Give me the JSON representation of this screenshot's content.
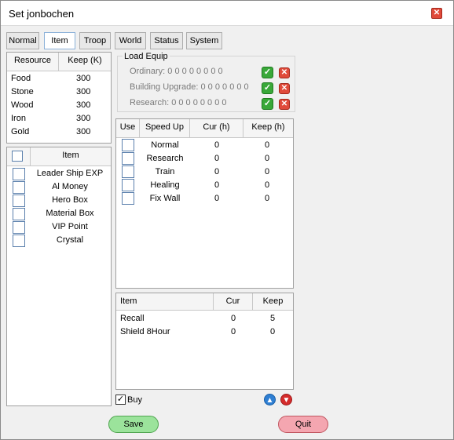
{
  "window": {
    "title": "Set jonbochen"
  },
  "tabs": [
    {
      "label": "Normal"
    },
    {
      "label": "Item"
    },
    {
      "label": "Troop"
    },
    {
      "label": "World"
    },
    {
      "label": "Status"
    },
    {
      "label": "System"
    }
  ],
  "active_tab": "Item",
  "resources": {
    "headers": {
      "resource": "Resource",
      "keep": "Keep (K)"
    },
    "rows": [
      {
        "name": "Food",
        "keep": "300"
      },
      {
        "name": "Stone",
        "keep": "300"
      },
      {
        "name": "Wood",
        "keep": "300"
      },
      {
        "name": "Iron",
        "keep": "300"
      },
      {
        "name": "Gold",
        "keep": "300"
      }
    ]
  },
  "items": {
    "header": "Item",
    "rows": [
      {
        "name": "Leader Ship EXP"
      },
      {
        "name": "Al Money"
      },
      {
        "name": "Hero Box"
      },
      {
        "name": "Material Box"
      },
      {
        "name": "VIP Point"
      },
      {
        "name": "Crystal"
      }
    ]
  },
  "load_equip": {
    "title": "Load Equip",
    "rows": [
      {
        "label": "Ordinary: 0 0 0 0 0 0 0 0"
      },
      {
        "label": "Building Upgrade: 0 0 0 0 0 0 0"
      },
      {
        "label": "Research: 0 0 0 0 0 0 0 0"
      }
    ]
  },
  "speedup": {
    "headers": {
      "use": "Use",
      "speed_up": "Speed Up",
      "cur": "Cur (h)",
      "keep": "Keep (h)"
    },
    "rows": [
      {
        "name": "Normal",
        "cur": "0",
        "keep": "0"
      },
      {
        "name": "Research",
        "cur": "0",
        "keep": "0"
      },
      {
        "name": "Train",
        "cur": "0",
        "keep": "0"
      },
      {
        "name": "Healing",
        "cur": "0",
        "keep": "0"
      },
      {
        "name": "Fix Wall",
        "cur": "0",
        "keep": "0"
      }
    ]
  },
  "item_table": {
    "headers": {
      "item": "Item",
      "cur": "Cur",
      "keep": "Keep"
    },
    "rows": [
      {
        "name": "Recall",
        "cur": "0",
        "keep": "5"
      },
      {
        "name": "Shield 8Hour",
        "cur": "0",
        "keep": "0"
      }
    ]
  },
  "buy": {
    "label": "Buy",
    "checked": true
  },
  "buttons": {
    "save": "Save",
    "quit": "Quit"
  },
  "icons": {
    "ok": "check-icon",
    "remove": "x-icon",
    "up": "arrow-up-icon",
    "down": "arrow-down-icon"
  },
  "colors": {
    "save_green": "#9be39b",
    "quit_red": "#f4a6b0",
    "ok_green": "#39a839",
    "remove_red": "#e04a3a",
    "up_blue": "#2f7fd3",
    "down_red": "#d42b2b"
  }
}
